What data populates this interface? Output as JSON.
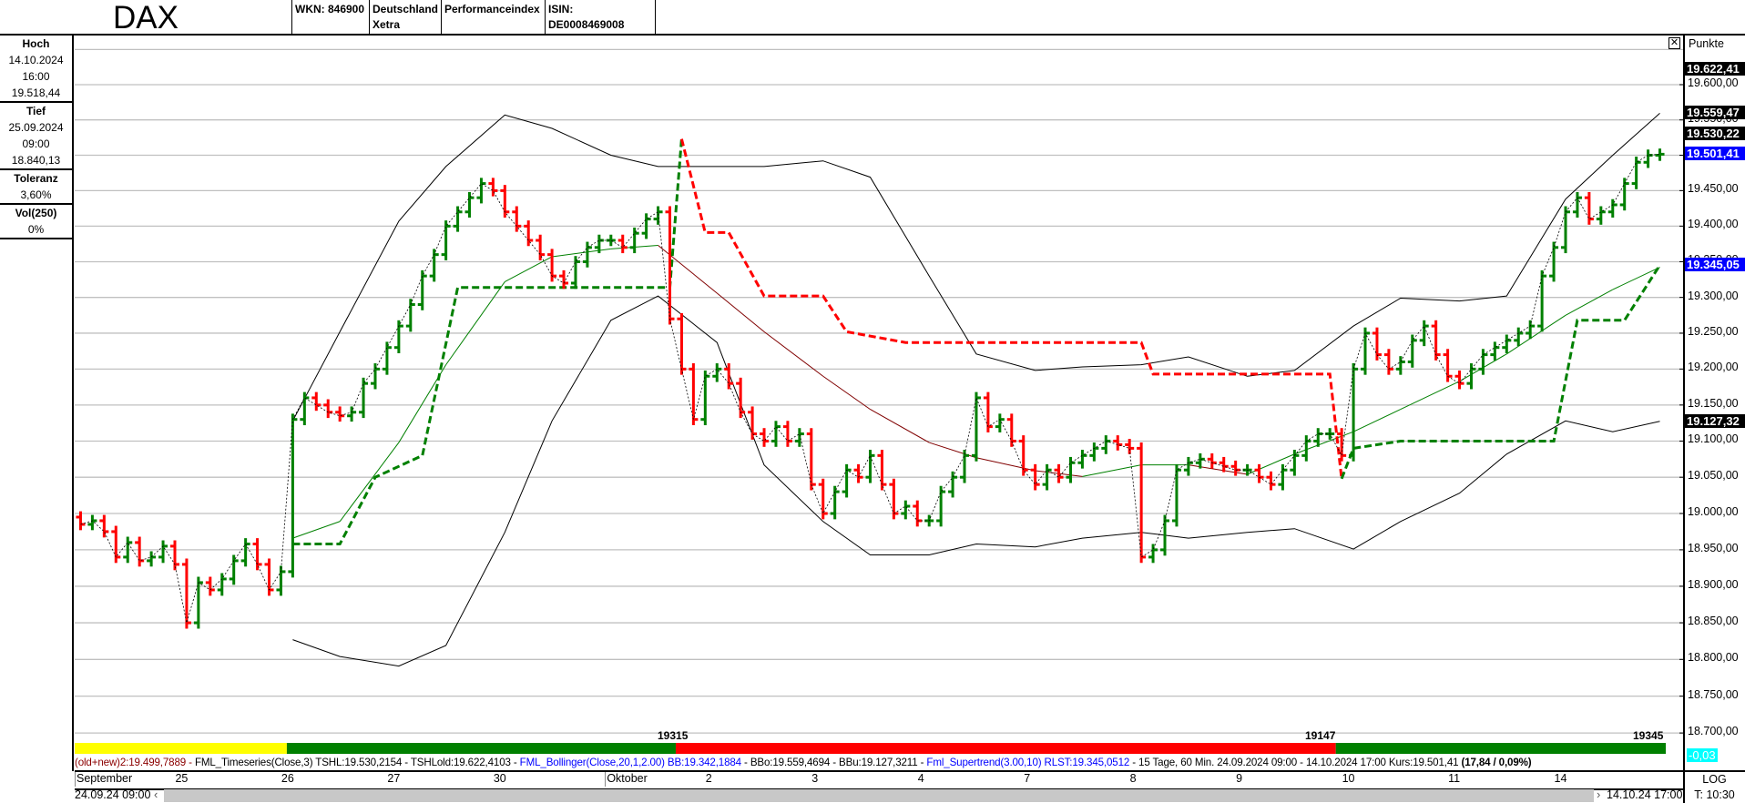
{
  "header": {
    "title": "DAX",
    "wkn": "WKN: 846900",
    "exchange_line1": "Deutschland",
    "exchange_line2": "Xetra",
    "type": "Performanceindex",
    "isin": "ISIN: DE0008469008"
  },
  "left_panel": {
    "high_label": "Hoch",
    "high_date": "14.10.2024",
    "high_time": "16:00",
    "high_value": "19.518,44",
    "low_label": "Tief",
    "low_date": "25.09.2024",
    "low_time": "09:00",
    "low_value": "18.840,13",
    "tolerance_label": "Toleranz",
    "tolerance_value": "3,60%",
    "vol_label": "Vol(250)",
    "vol_value": "0%"
  },
  "right_axis": {
    "unit_label": "Punkte",
    "scale": "LOG",
    "time": "T: 10:30",
    "change_tag": "-0,03",
    "tags": [
      {
        "value": 19622.41,
        "text": "19.622,41",
        "color": "#000000"
      },
      {
        "value": 19559.47,
        "text": "19.559,47",
        "color": "#000000"
      },
      {
        "value": 19530.22,
        "text": "19.530,22",
        "color": "#000000"
      },
      {
        "value": 19501.41,
        "text": "19.501,41",
        "color": "#0000ff"
      },
      {
        "value": 19345.05,
        "text": "19.345,05",
        "color": "#0000ff"
      },
      {
        "value": 19127.32,
        "text": "19.127,32",
        "color": "#000000"
      }
    ]
  },
  "info_line": {
    "part1": "(old+new)2:19.499,7889 - ",
    "part2": "FML_Timeseries(Close,3) TSHL:19.530,2154 - TSHLold:19.622,4103 - ",
    "part3": "FML_Bollinger(Close,20,1,2.00) BB:19.342,1884",
    "part4": " - BBo:19.559,4694 - BBu:19.127,3211 - ",
    "part5": "Fml_Supertrend(3.00,10) RLST:19.345,0512",
    "part6": " - 15 Tage, 60 Min. 24.09.2024 09:00 - 14.10.2024 17:00  Kurs:19.501,41 ",
    "part7": "(17,84 / 0,09%)"
  },
  "navigation": {
    "start": "24.09.24 09:00",
    "end": "14.10.24 17:00",
    "left_arrow": "‹",
    "right_arrow": "›"
  },
  "trend_bar": {
    "segments": [
      {
        "from": "24.09 09:00",
        "to": "26.09 09:00",
        "color": "#ffff00"
      },
      {
        "from": "26.09 09:00",
        "to": "01.10 15:00",
        "color": "#008000"
      },
      {
        "from": "01.10 15:00",
        "to": "09.10 17:00",
        "color": "#ff0000"
      },
      {
        "from": "09.10 17:00",
        "to": "14.10 17:00",
        "color": "#008000"
      }
    ],
    "labels": [
      "19315",
      "19147",
      "19345"
    ]
  },
  "chart_data": {
    "type": "ohlc",
    "interval": "60 Min.",
    "yscale": "log",
    "ylim": [
      18680,
      19680
    ],
    "grid": true,
    "y_ticks": [
      18700,
      18750,
      18800,
      18850,
      18900,
      18950,
      19000,
      19050,
      19100,
      19150,
      19200,
      19250,
      19300,
      19350,
      19400,
      19450,
      19500,
      19550,
      19600
    ],
    "y_tick_labels": [
      "18.700,00",
      "18.750,00",
      "18.800,00",
      "18.850,00",
      "18.900,00",
      "18.950,00",
      "19.000,00",
      "19.050,00",
      "19.100,00",
      "19.150,00",
      "19.200,00",
      "19.250,00",
      "19.300,00",
      "19.350,00",
      "19.400,00",
      "19.450,00",
      "19.500,00",
      "19.550,00",
      "19.600,00"
    ],
    "x_labels": [
      "September",
      "25",
      "26",
      "27",
      "30",
      "Oktober",
      "2",
      "3",
      "4",
      "7",
      "8",
      "9",
      "10",
      "11",
      "14"
    ],
    "days": [
      "24.09",
      "25.09",
      "26.09",
      "27.09",
      "30.09",
      "01.10",
      "02.10",
      "03.10",
      "04.10",
      "07.10",
      "08.10",
      "09.10",
      "10.10",
      "11.10",
      "14.10"
    ],
    "hours": [
      9,
      10,
      11,
      12,
      13,
      14,
      15,
      16,
      17
    ],
    "close_by_day": [
      [
        18985,
        18990,
        18975,
        18940,
        18960,
        18935,
        18940,
        18955,
        18930
      ],
      [
        18850,
        18905,
        18895,
        18910,
        18935,
        18958,
        18930,
        18895,
        18920
      ],
      [
        19130,
        19160,
        19150,
        19140,
        19135,
        19140,
        19180,
        19200,
        19230
      ],
      [
        19260,
        19290,
        19330,
        19360,
        19400,
        19420,
        19440,
        19460,
        19450
      ],
      [
        19420,
        19400,
        19380,
        19360,
        19330,
        19320,
        19350,
        19370,
        19380
      ],
      [
        19380,
        19370,
        19390,
        19410,
        19420,
        19270,
        19200,
        19130,
        19190
      ],
      [
        19200,
        19180,
        19140,
        19110,
        19100,
        19120,
        19100,
        19110,
        19040
      ],
      [
        19000,
        19030,
        19060,
        19050,
        19080,
        19040,
        19000,
        19010,
        18990
      ],
      [
        18990,
        19030,
        19050,
        19080,
        19160,
        19120,
        19130,
        19100,
        19060
      ],
      [
        19040,
        19060,
        19050,
        19070,
        19080,
        19090,
        19100,
        19095,
        19090
      ],
      [
        18940,
        18950,
        18990,
        19060,
        19070,
        19075,
        19070,
        19065,
        19060
      ],
      [
        19060,
        19050,
        19040,
        19060,
        19080,
        19100,
        19110,
        19110,
        19080
      ],
      [
        19200,
        19250,
        19220,
        19200,
        19210,
        19240,
        19260,
        19220,
        19190
      ],
      [
        19180,
        19200,
        19220,
        19230,
        19240,
        19250,
        19260,
        19330,
        19370
      ],
      [
        19420,
        19440,
        19410,
        19420,
        19430,
        19460,
        19490,
        19500,
        19501.41
      ]
    ],
    "bollinger_upper": [
      [
        "26.09 09:00",
        19128
      ],
      [
        "26.09 13:00",
        19252
      ],
      [
        "27.09 09:00",
        19407
      ],
      [
        "27.09 13:00",
        19484
      ],
      [
        "30.09 09:00",
        19557
      ],
      [
        "30.09 13:00",
        19538
      ],
      [
        "01.10 09:00",
        19500
      ],
      [
        "01.10 13:00",
        19484
      ],
      [
        "02.10 09:00",
        19484
      ],
      [
        "02.10 13:00",
        19484
      ],
      [
        "03.10 09:00",
        19492
      ],
      [
        "03.10 13:00",
        19469
      ],
      [
        "04.10 09:00",
        19330
      ],
      [
        "04.10 13:00",
        19221
      ],
      [
        "07.10 09:00",
        19198
      ],
      [
        "07.10 13:00",
        19203
      ],
      [
        "08.10 09:00",
        19206
      ],
      [
        "08.10 13:00",
        19217
      ],
      [
        "09.10 09:00",
        19190
      ],
      [
        "09.10 13:00",
        19198
      ],
      [
        "10.10 09:00",
        19260
      ],
      [
        "10.10 13:00",
        19299
      ],
      [
        "11.10 09:00",
        19295
      ],
      [
        "11.10 13:00",
        19302
      ],
      [
        "14.10 09:00",
        19438
      ],
      [
        "14.10 13:00",
        19500
      ],
      [
        "14.10 17:00",
        19559.47
      ]
    ],
    "bollinger_middle": [
      [
        "26.09 09:00",
        18966
      ],
      [
        "26.09 13:00",
        18989
      ],
      [
        "27.09 09:00",
        19098
      ],
      [
        "27.09 13:00",
        19206
      ],
      [
        "30.09 09:00",
        19322
      ],
      [
        "30.09 13:00",
        19357
      ],
      [
        "01.10 09:00",
        19368
      ],
      [
        "01.10 13:00",
        19373
      ],
      [
        "02.10 09:00",
        19306
      ],
      [
        "02.10 13:00",
        19252
      ],
      [
        "03.10 09:00",
        19190
      ],
      [
        "03.10 13:00",
        19144
      ],
      [
        "04.10 09:00",
        19098
      ],
      [
        "04.10 13:00",
        19077
      ],
      [
        "07.10 09:00",
        19059
      ],
      [
        "07.10 13:00",
        19051
      ],
      [
        "08.10 09:00",
        19067
      ],
      [
        "08.10 13:00",
        19067
      ],
      [
        "09.10 09:00",
        19054
      ],
      [
        "09.10 13:00",
        19082
      ],
      [
        "10.10 09:00",
        19113
      ],
      [
        "10.10 13:00",
        19144
      ],
      [
        "11.10 09:00",
        19183
      ],
      [
        "11.10 13:00",
        19221
      ],
      [
        "14.10 09:00",
        19275
      ],
      [
        "14.10 13:00",
        19311
      ],
      [
        "14.10 17:00",
        19342.19
      ]
    ],
    "bollinger_lower": [
      [
        "26.09 09:00",
        18827
      ],
      [
        "26.09 13:00",
        18804
      ],
      [
        "27.09 09:00",
        18791
      ],
      [
        "27.09 13:00",
        18819
      ],
      [
        "30.09 09:00",
        18974
      ],
      [
        "30.09 13:00",
        19128
      ],
      [
        "01.10 09:00",
        19268
      ],
      [
        "01.10 13:00",
        19302
      ],
      [
        "02.10 09:00",
        19237
      ],
      [
        "02.10 13:00",
        19067
      ],
      [
        "03.10 09:00",
        18989
      ],
      [
        "03.10 13:00",
        18943
      ],
      [
        "04.10 09:00",
        18943
      ],
      [
        "04.10 13:00",
        18958
      ],
      [
        "07.10 09:00",
        18954
      ],
      [
        "07.10 13:00",
        18966
      ],
      [
        "08.10 09:00",
        18974
      ],
      [
        "08.10 13:00",
        18966
      ],
      [
        "09.10 09:00",
        18974
      ],
      [
        "09.10 13:00",
        18979
      ],
      [
        "10.10 09:00",
        18951
      ],
      [
        "10.10 13:00",
        18989
      ],
      [
        "11.10 09:00",
        19028
      ],
      [
        "11.10 13:00",
        19082
      ],
      [
        "14.10 09:00",
        19128
      ],
      [
        "14.10 13:00",
        19113
      ],
      [
        "14.10 17:00",
        19127.32
      ]
    ],
    "supertrend": [
      {
        "trend": "up",
        "color": "#008000",
        "points": [
          [
            "26.09 09:00",
            18958
          ],
          [
            "26.09 13:00",
            18958
          ],
          [
            "26.09 16:00",
            19050
          ],
          [
            "27.09 11:00",
            19080
          ],
          [
            "27.09 14:00",
            19314
          ],
          [
            "01.10 14:00",
            19314
          ],
          [
            "01.10 15:00",
            19523
          ]
        ]
      },
      {
        "trend": "down",
        "color": "#ff0000",
        "points": [
          [
            "01.10 15:00",
            19523
          ],
          [
            "01.10 17:00",
            19391
          ],
          [
            "02.10 10:00",
            19391
          ],
          [
            "02.10 13:00",
            19302
          ],
          [
            "03.10 09:00",
            19302
          ],
          [
            "03.10 11:00",
            19252
          ],
          [
            "03.10 16:00",
            19237
          ],
          [
            "08.10 09:00",
            19237
          ],
          [
            "08.10 10:00",
            19193
          ],
          [
            "09.10 16:00",
            19193
          ],
          [
            "09.10 17:00",
            19048
          ]
        ]
      },
      {
        "trend": "up",
        "color": "#008000",
        "points": [
          [
            "09.10 17:00",
            19048
          ],
          [
            "10.10 09:00",
            19090
          ],
          [
            "10.10 13:00",
            19100
          ],
          [
            "11.10 17:00",
            19100
          ],
          [
            "14.10 10:00",
            19268
          ],
          [
            "14.10 14:00",
            19268
          ],
          [
            "14.10 17:00",
            19345.05
          ]
        ]
      }
    ],
    "colors": {
      "up": "#008000",
      "down": "#ff0000",
      "bollinger": "#000000",
      "middle_up": "#008000",
      "middle_down": "#800000",
      "grid": "#c0c0c0"
    }
  }
}
